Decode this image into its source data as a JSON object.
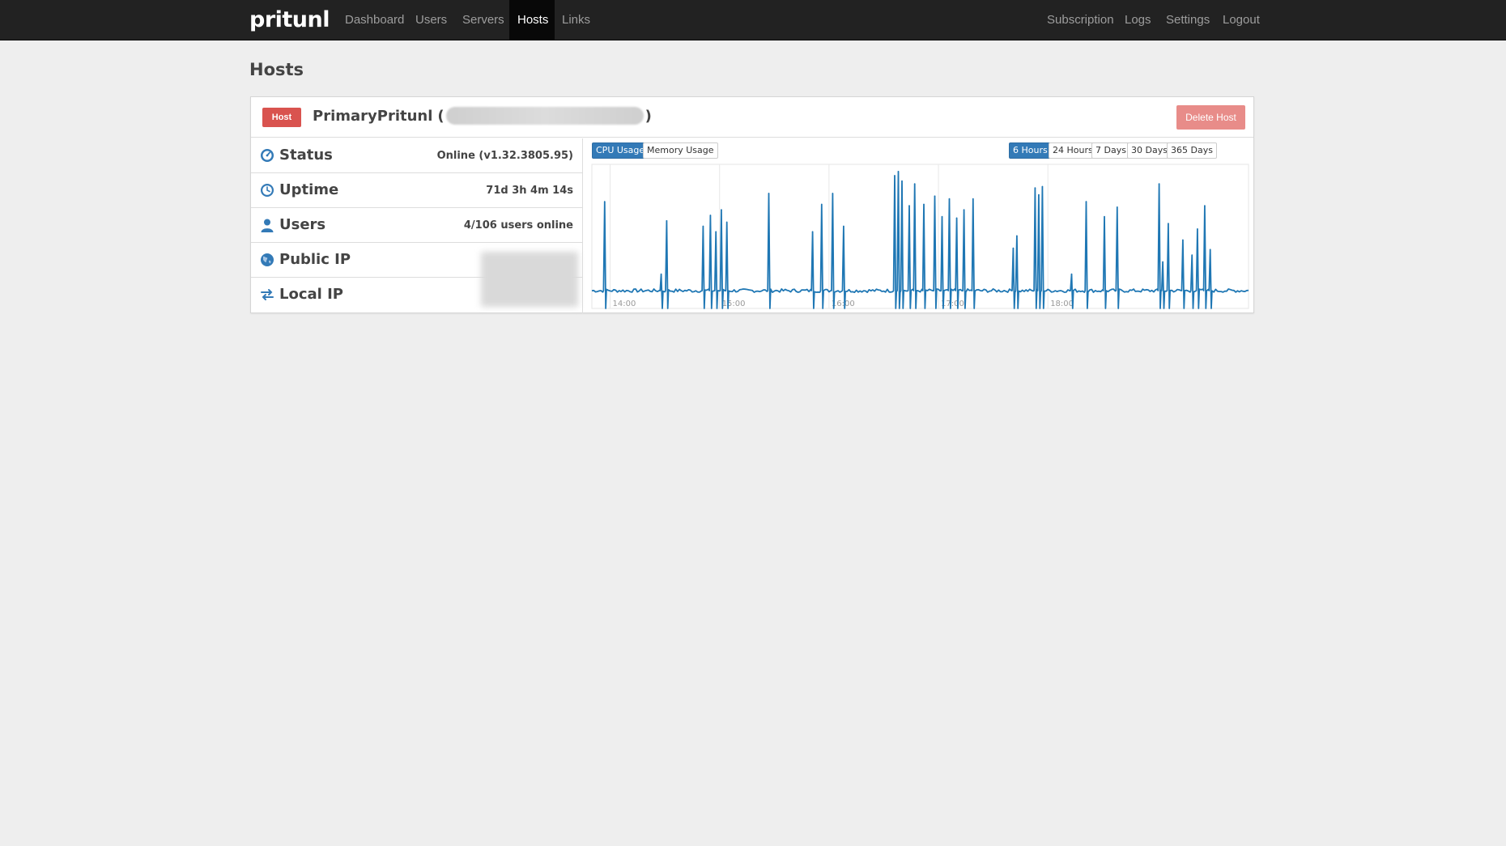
{
  "navbar": {
    "brand": "pritunl",
    "left_items": [
      {
        "label": "Dashboard",
        "active": false
      },
      {
        "label": "Users",
        "active": false
      },
      {
        "label": "Servers",
        "active": false
      },
      {
        "label": "Hosts",
        "active": true
      },
      {
        "label": "Links",
        "active": false
      }
    ],
    "right_items": [
      {
        "label": "Subscription"
      },
      {
        "label": "Logs"
      },
      {
        "label": "Settings"
      },
      {
        "label": "Logout"
      }
    ]
  },
  "page": {
    "title": "Hosts"
  },
  "host": {
    "badge": "Host",
    "name": "PrimaryPritunl",
    "name_open": "(",
    "name_close": ")",
    "delete_label": "Delete Host",
    "stats": [
      {
        "label": "Status",
        "value": "Online (v1.32.3805.95)",
        "icon": "dashboard-icon"
      },
      {
        "label": "Uptime",
        "value": "71d 3h 4m 14s",
        "icon": "clock-icon"
      },
      {
        "label": "Users",
        "value": "4/106 users online",
        "icon": "user-icon"
      },
      {
        "label": "Public IP",
        "value": "",
        "icon": "globe-icon"
      },
      {
        "label": "Local IP",
        "value": "",
        "icon": "transfer-icon"
      }
    ]
  },
  "chart_controls": {
    "metric_tabs": [
      {
        "label": "CPU Usage",
        "active": true
      },
      {
        "label": "Memory Usage",
        "active": false
      }
    ],
    "range_tabs": [
      {
        "label": "6 Hours",
        "active": true
      },
      {
        "label": "24 Hours",
        "active": false
      },
      {
        "label": "7 Days",
        "active": false
      },
      {
        "label": "30 Days",
        "active": false
      },
      {
        "label": "365 Days",
        "active": false
      }
    ]
  },
  "colors": {
    "accent": "#337ab7",
    "line": "#1f77b4",
    "danger": "#d9534f",
    "navbar": "#222222"
  },
  "chart_data": {
    "type": "line",
    "title": "",
    "xlabel": "",
    "ylabel": "",
    "x_ticks": [
      "14:00",
      "15:00",
      "16:00",
      "17:00",
      "18:00"
    ],
    "grid": true,
    "x_start_minutes": 830,
    "x_end_minutes": 1190,
    "ylim": [
      0,
      1
    ],
    "spikes": [
      {
        "t": 837,
        "v": 0.78
      },
      {
        "t": 868,
        "v": 0.25
      },
      {
        "t": 871,
        "v": 0.64
      },
      {
        "t": 891,
        "v": 0.6
      },
      {
        "t": 895,
        "v": 0.68
      },
      {
        "t": 898,
        "v": 0.56
      },
      {
        "t": 901,
        "v": 0.72
      },
      {
        "t": 904,
        "v": 0.63
      },
      {
        "t": 927,
        "v": 0.84
      },
      {
        "t": 951,
        "v": 0.56
      },
      {
        "t": 956,
        "v": 0.76
      },
      {
        "t": 962,
        "v": 0.84
      },
      {
        "t": 968,
        "v": 0.6
      },
      {
        "t": 996,
        "v": 0.97
      },
      {
        "t": 998,
        "v": 1.0
      },
      {
        "t": 1000,
        "v": 0.93
      },
      {
        "t": 1004,
        "v": 0.75
      },
      {
        "t": 1007,
        "v": 0.91
      },
      {
        "t": 1012,
        "v": 0.76
      },
      {
        "t": 1018,
        "v": 0.82
      },
      {
        "t": 1022,
        "v": 0.67
      },
      {
        "t": 1026,
        "v": 0.8
      },
      {
        "t": 1030,
        "v": 0.66
      },
      {
        "t": 1034,
        "v": 0.72
      },
      {
        "t": 1039,
        "v": 0.8
      },
      {
        "t": 1061,
        "v": 0.44
      },
      {
        "t": 1063,
        "v": 0.53
      },
      {
        "t": 1073,
        "v": 0.88
      },
      {
        "t": 1075,
        "v": 0.83
      },
      {
        "t": 1077,
        "v": 0.89
      },
      {
        "t": 1093,
        "v": 0.25
      },
      {
        "t": 1101,
        "v": 0.78
      },
      {
        "t": 1111,
        "v": 0.67
      },
      {
        "t": 1118,
        "v": 0.74
      },
      {
        "t": 1141,
        "v": 0.91
      },
      {
        "t": 1143,
        "v": 0.34
      },
      {
        "t": 1146,
        "v": 0.62
      },
      {
        "t": 1154,
        "v": 0.5
      },
      {
        "t": 1159,
        "v": 0.39
      },
      {
        "t": 1162,
        "v": 0.58
      },
      {
        "t": 1166,
        "v": 0.75
      },
      {
        "t": 1169,
        "v": 0.43
      }
    ],
    "baseline": 0.13
  }
}
